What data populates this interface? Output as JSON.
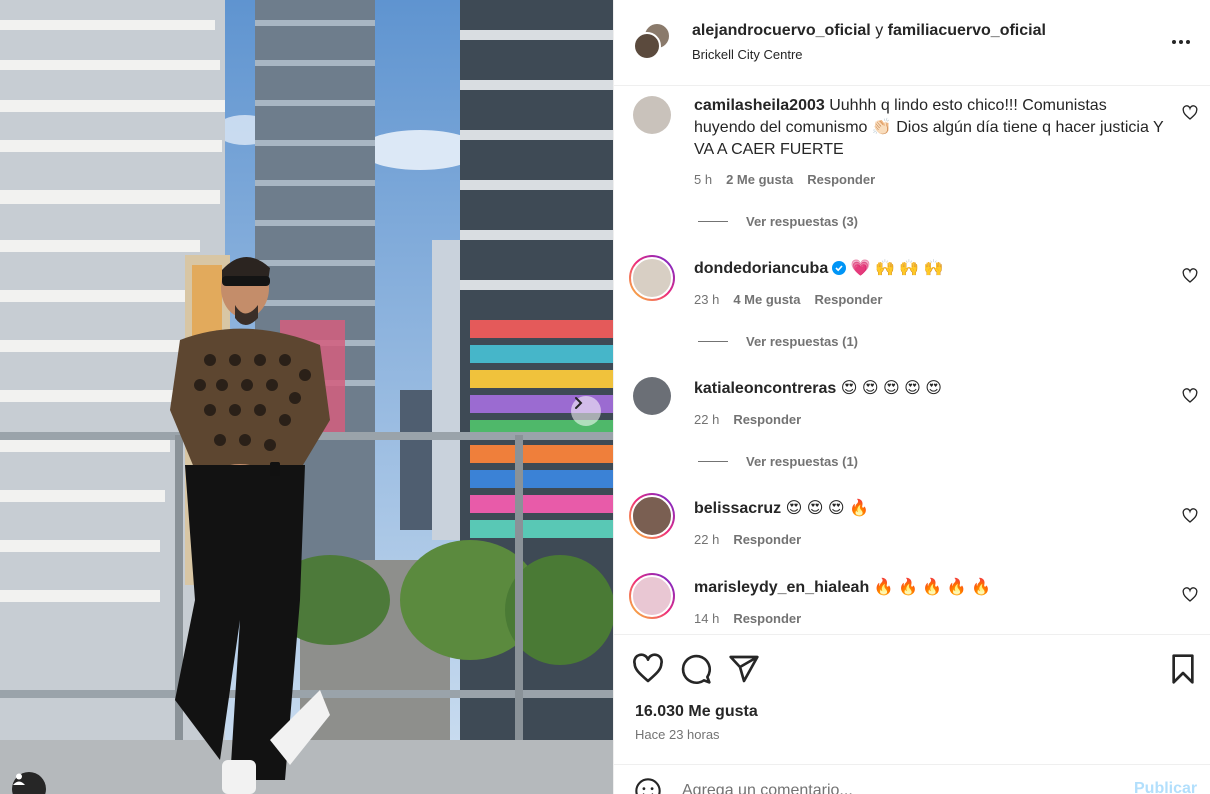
{
  "post": {
    "author": "alejandrocuervo_oficial",
    "connector": "y",
    "coauthor": "familiacuervo_oficial",
    "location": "Brickell City Centre"
  },
  "comments": [
    {
      "user": "camilasheila2003",
      "text": "Uuhhh q lindo esto chico!!! Comunistas huyendo del comunismo 👏🏻 Dios algún día tiene q hacer justicia Y VA A CAER FUERTE",
      "time": "5 h",
      "likes": "2 Me gusta",
      "reply_label": "Responder",
      "view_replies": "Ver respuestas (3)",
      "avatar_color": "#c9c2bb"
    },
    {
      "user": "dondedoriancuba",
      "verified": true,
      "text": "💗 🙌 🙌 🙌",
      "time": "23 h",
      "likes": "4 Me gusta",
      "reply_label": "Responder",
      "view_replies": "Ver respuestas (1)",
      "avatar_color": "#d8cfc4"
    },
    {
      "user": "katialeoncontreras",
      "text": "😍 😍 😍 😍 😍",
      "time": "22 h",
      "reply_label": "Responder",
      "view_replies": "Ver respuestas (1)",
      "avatar_color": "#6b6f76"
    },
    {
      "user": "belissacruz",
      "text": "😍 😍 😍 🔥",
      "time": "22 h",
      "reply_label": "Responder",
      "avatar_color": "#7a5f52"
    },
    {
      "user": "marisleydy_en_hialeah",
      "text": "🔥 🔥 🔥 🔥 🔥",
      "time": "14 h",
      "reply_label": "Responder",
      "avatar_color": "#e9c7d3"
    }
  ],
  "stats": {
    "likes": "16.030 Me gusta",
    "time_ago": "Hace 23 horas"
  },
  "composer": {
    "placeholder": "Agrega un comentario...",
    "publish_label": "Publicar"
  },
  "icons": {
    "more": "more-options-icon",
    "heart": "heart-icon",
    "comment": "comment-icon",
    "share": "share-icon",
    "save": "bookmark-icon",
    "emoji": "emoji-icon",
    "next": "chevron-right-icon",
    "tag": "user-tag-icon"
  },
  "colors": {
    "text": "#262626",
    "secondary": "#737373",
    "publish_disabled": "#b2dffc",
    "verified": "#0095f6"
  }
}
